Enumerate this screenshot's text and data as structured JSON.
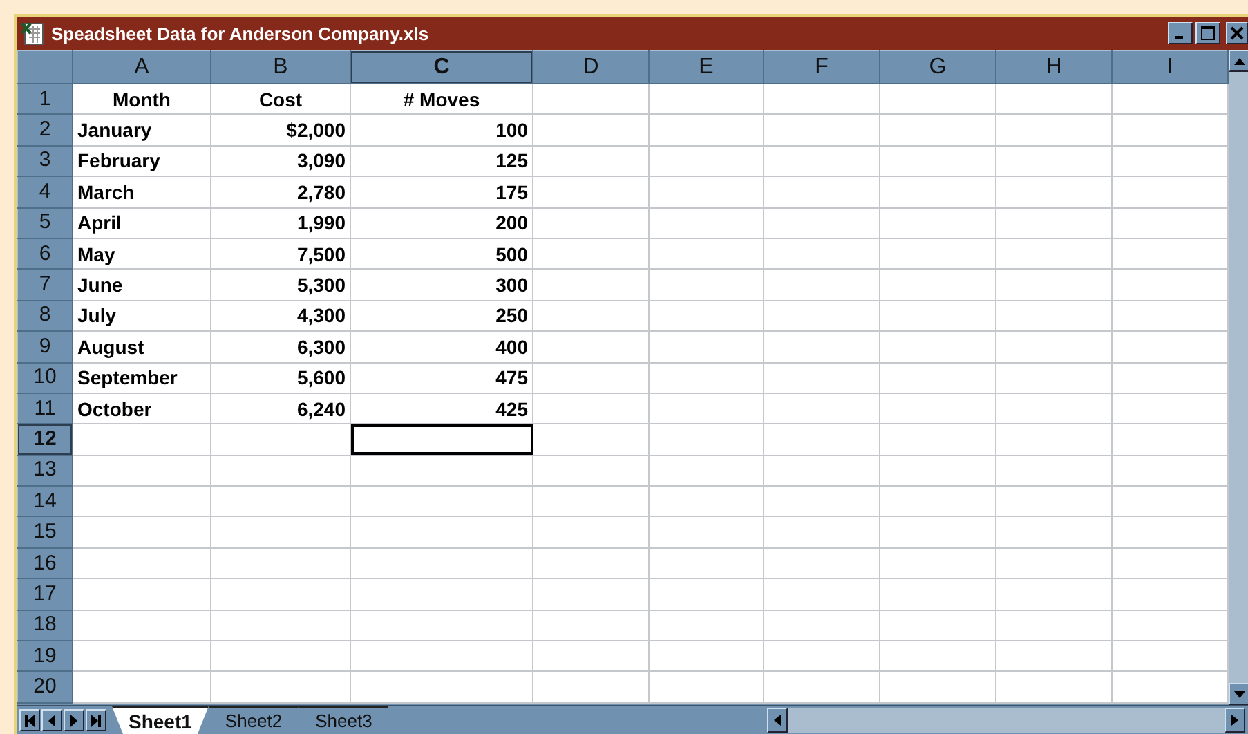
{
  "window": {
    "title": "Speadsheet Data for Anderson Company.xls"
  },
  "columns": [
    {
      "label": "A",
      "selected": false
    },
    {
      "label": "B",
      "selected": false
    },
    {
      "label": "C",
      "selected": true
    },
    {
      "label": "D",
      "selected": false
    },
    {
      "label": "E",
      "selected": false
    },
    {
      "label": "F",
      "selected": false
    },
    {
      "label": "G",
      "selected": false
    },
    {
      "label": "H",
      "selected": false
    },
    {
      "label": "I",
      "selected": false
    }
  ],
  "rows": [
    {
      "number": "1",
      "selected": false,
      "cells": [
        "Month",
        "Cost",
        "# Moves"
      ]
    },
    {
      "number": "2",
      "selected": false,
      "cells": [
        "January",
        "$2,000",
        "100"
      ]
    },
    {
      "number": "3",
      "selected": false,
      "cells": [
        "February",
        "3,090",
        "125"
      ]
    },
    {
      "number": "4",
      "selected": false,
      "cells": [
        "March",
        "2,780",
        "175"
      ]
    },
    {
      "number": "5",
      "selected": false,
      "cells": [
        "April",
        "1,990",
        "200"
      ]
    },
    {
      "number": "6",
      "selected": false,
      "cells": [
        "May",
        "7,500",
        "500"
      ]
    },
    {
      "number": "7",
      "selected": false,
      "cells": [
        "June",
        "5,300",
        "300"
      ]
    },
    {
      "number": "8",
      "selected": false,
      "cells": [
        "July",
        "4,300",
        "250"
      ]
    },
    {
      "number": "9",
      "selected": false,
      "cells": [
        "August",
        "6,300",
        "400"
      ]
    },
    {
      "number": "10",
      "selected": false,
      "cells": [
        "September",
        "5,600",
        "475"
      ]
    },
    {
      "number": "11",
      "selected": false,
      "cells": [
        "October",
        "6,240",
        "425"
      ]
    },
    {
      "number": "12",
      "selected": true,
      "cells": []
    },
    {
      "number": "13",
      "selected": false,
      "cells": []
    },
    {
      "number": "14",
      "selected": false,
      "cells": []
    },
    {
      "number": "15",
      "selected": false,
      "cells": []
    },
    {
      "number": "16",
      "selected": false,
      "cells": []
    },
    {
      "number": "17",
      "selected": false,
      "cells": []
    },
    {
      "number": "18",
      "selected": false,
      "cells": []
    },
    {
      "number": "19",
      "selected": false,
      "cells": []
    },
    {
      "number": "20",
      "selected": false,
      "cells": []
    }
  ],
  "sheet_tabs": [
    {
      "label": "Sheet1",
      "selected": true
    },
    {
      "label": "Sheet2",
      "selected": false
    },
    {
      "label": "Sheet3",
      "selected": false
    }
  ]
}
